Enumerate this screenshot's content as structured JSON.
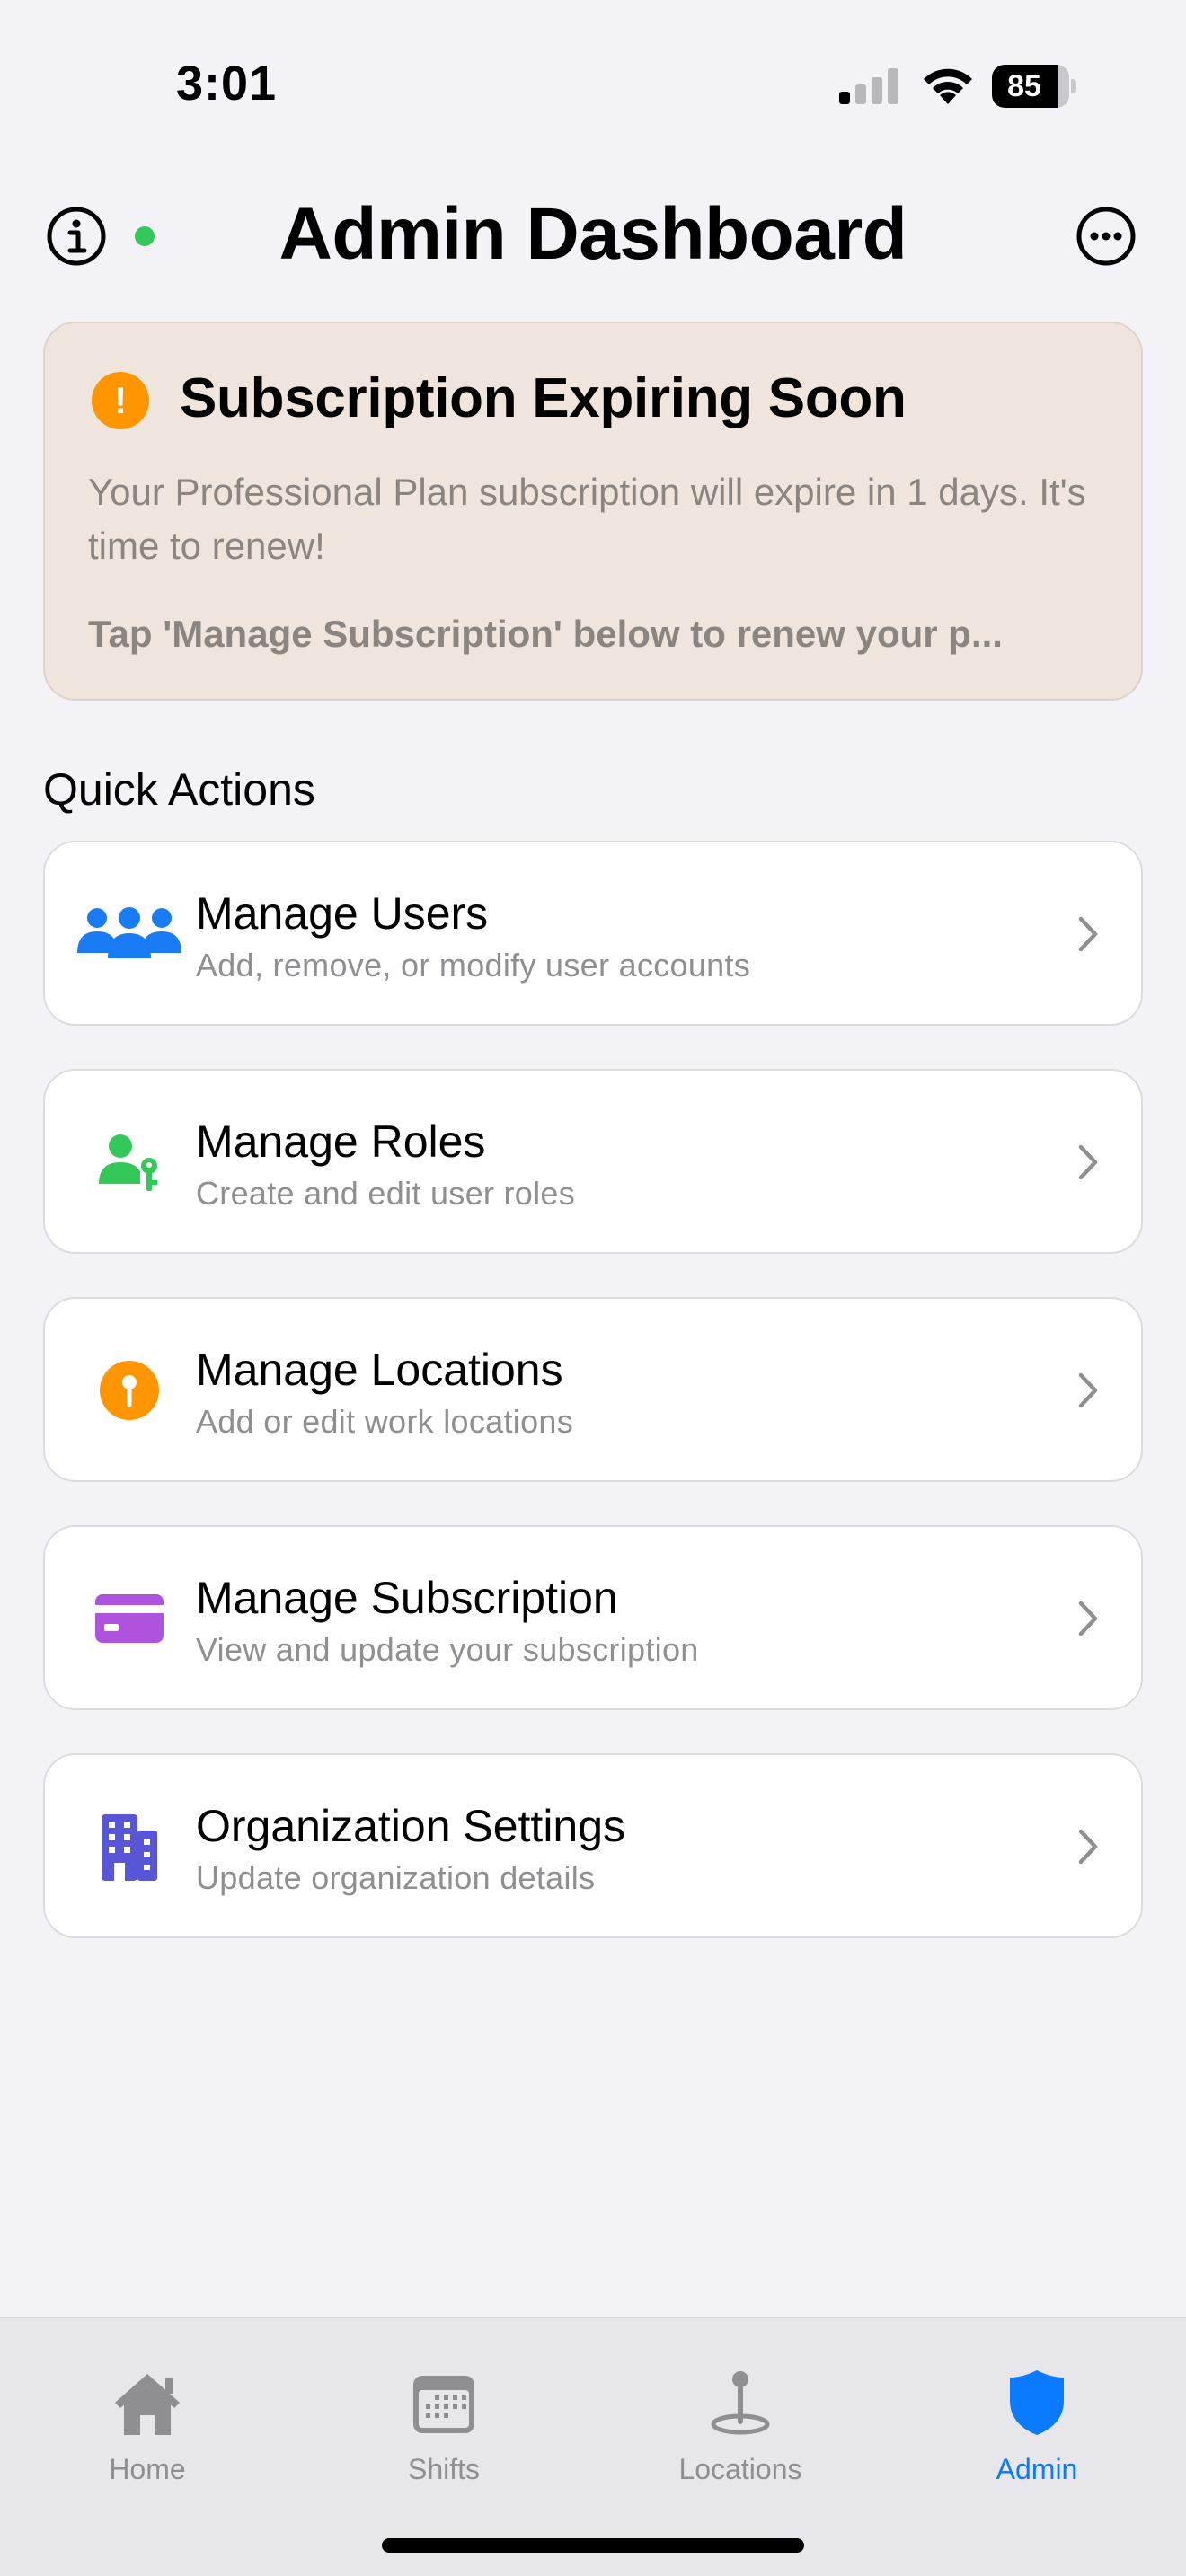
{
  "status_bar": {
    "time": "3:01",
    "battery_level": "85",
    "battery_fraction": 0.85,
    "signal_bars_active": 1,
    "signal_bars_total": 4
  },
  "header": {
    "title": "Admin Dashboard",
    "info_icon": "info-circle-icon",
    "more_icon": "ellipsis-circle-icon",
    "status_dot_color": "#34c759"
  },
  "alert": {
    "title": "Subscription Expiring Soon",
    "message": "Your Professional Plan subscription will expire in 1 days. It's time to renew!",
    "hint": "Tap 'Manage Subscription' below to renew your p...",
    "icon": "exclamation-circle-icon",
    "accent_color": "#ff9500"
  },
  "quick_actions": {
    "title": "Quick Actions",
    "items": [
      {
        "label": "Manage Users",
        "subtitle": "Add, remove, or modify user accounts",
        "icon": "users-icon",
        "color": "#1a7cf5"
      },
      {
        "label": "Manage Roles",
        "subtitle": "Create and edit user roles",
        "icon": "person-key-icon",
        "color": "#34c759"
      },
      {
        "label": "Manage Locations",
        "subtitle": "Add or edit work locations",
        "icon": "map-pin-icon",
        "color": "#ff9500"
      },
      {
        "label": "Manage Subscription",
        "subtitle": "View and update your subscription",
        "icon": "credit-card-icon",
        "color": "#af52de"
      },
      {
        "label": "Organization Settings",
        "subtitle": "Update organization details",
        "icon": "building-icon",
        "color": "#5856d6"
      }
    ]
  },
  "tab_bar": {
    "active": "Admin",
    "tabs": [
      {
        "label": "Home",
        "icon": "house-icon"
      },
      {
        "label": "Shifts",
        "icon": "calendar-icon"
      },
      {
        "label": "Locations",
        "icon": "map-pin-icon"
      },
      {
        "label": "Admin",
        "icon": "shield-icon"
      }
    ],
    "active_color": "#0a7aff",
    "inactive_color": "#8e8e93"
  }
}
